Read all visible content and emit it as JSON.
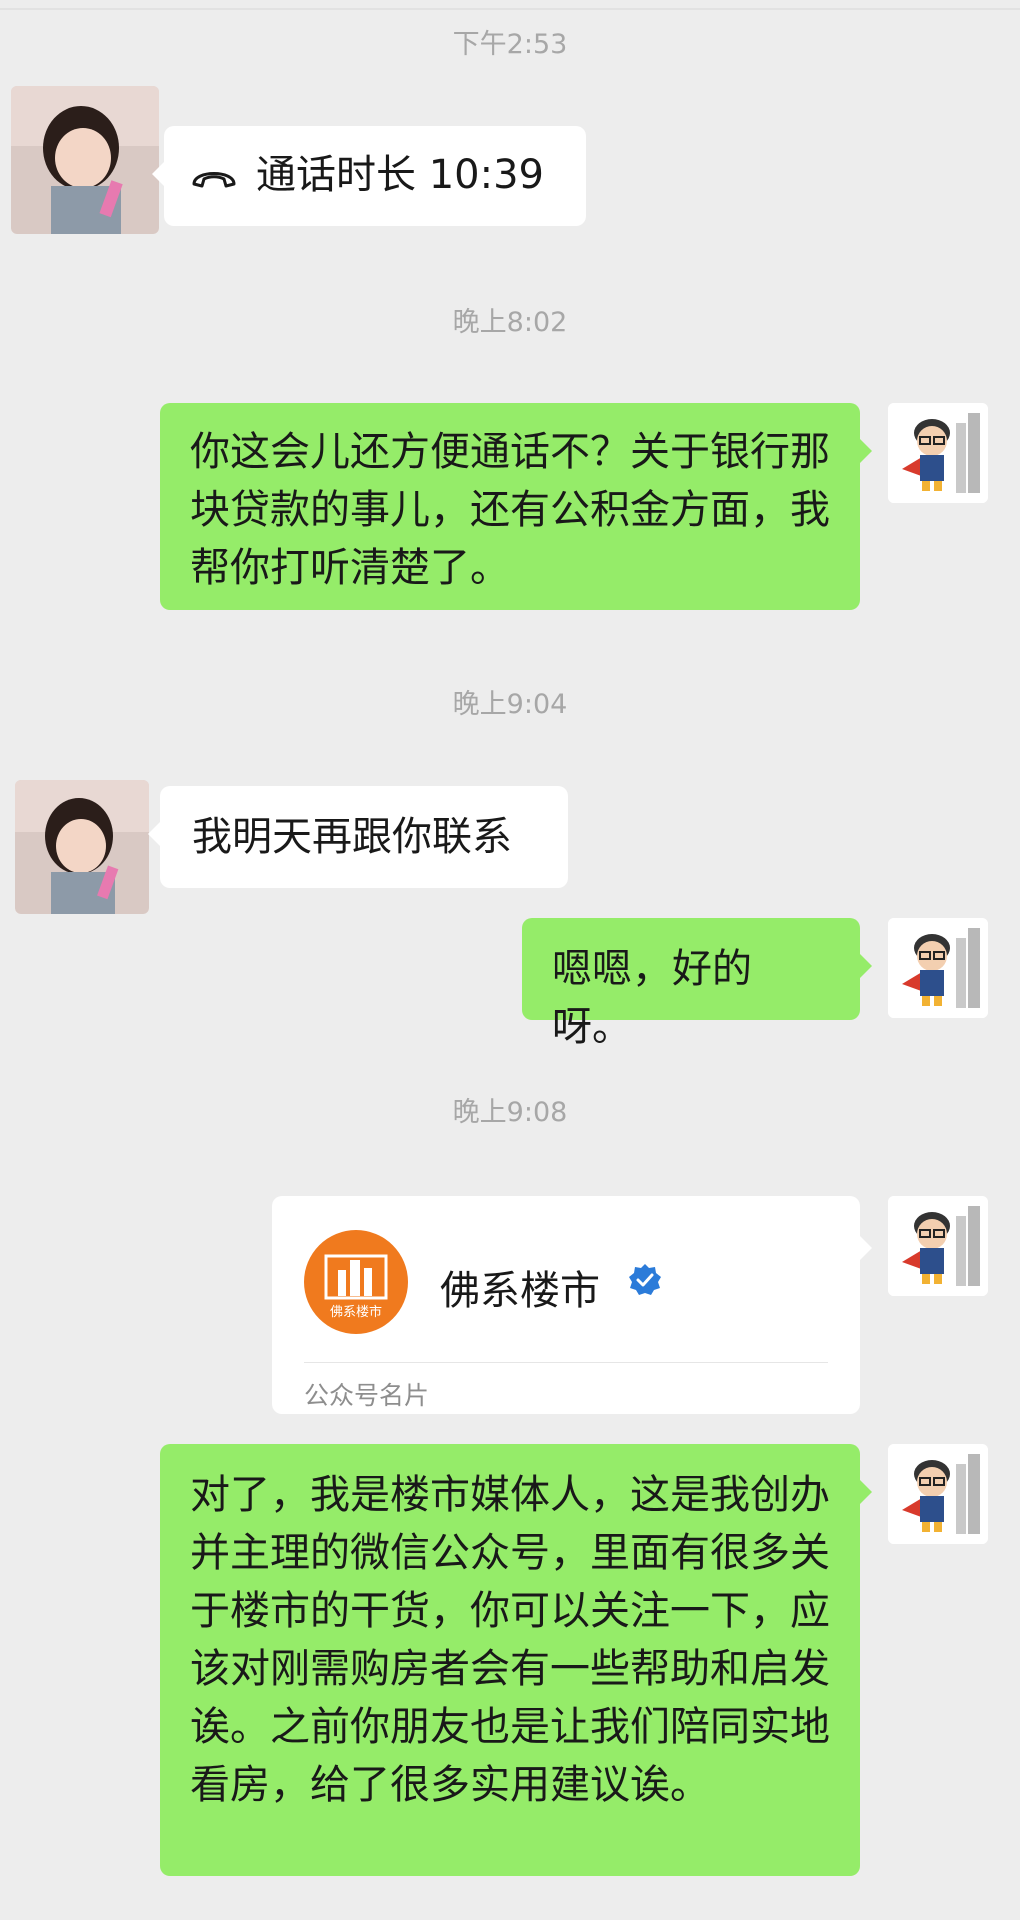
{
  "chat": {
    "times": [
      "下午2:53",
      "晚上8:02",
      "晚上9:04",
      "晚上9:08"
    ],
    "call": {
      "icon": "phone-hangup-icon",
      "text": "通话时长 10:39"
    },
    "messages": [
      "你这会儿还方便通话不？关于银行那块贷款的事儿，还有公积金方面，我帮你打听清楚了。",
      "我明天再跟你联系",
      "嗯嗯，好的呀。",
      "对了，我是楼市媒体人，这是我创办并主理的微信公众号，里面有很多关于楼市的干货，你可以关注一下，应该对刚需购房者会有一些帮助和启发诶。之前你朋友也是让我们陪同实地看房，给了很多实用建议诶。"
    ],
    "card": {
      "logo_text": "佛系楼市",
      "name": "佛系楼市",
      "footer": "公众号名片",
      "verified_color": "#2b7bd9"
    },
    "colors": {
      "sent_bubble": "#95ec69",
      "received_bubble": "#ffffff",
      "background": "#ededed",
      "card_logo": "#f07a1e"
    }
  }
}
